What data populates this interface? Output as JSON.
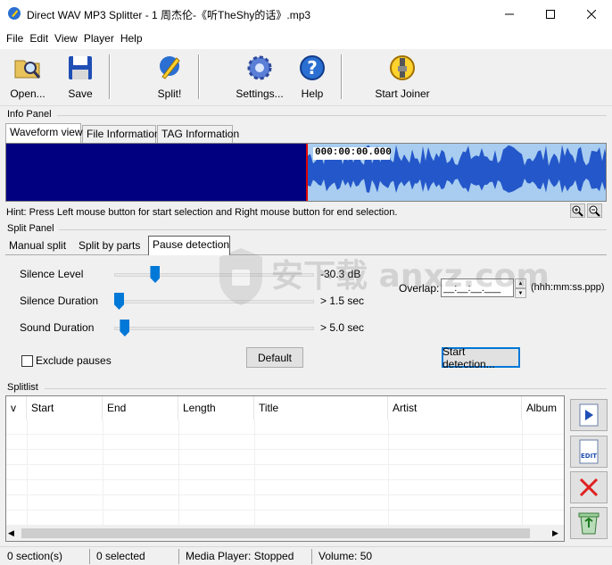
{
  "window": {
    "title": "Direct WAV MP3 Splitter - 1 周杰伦-《听TheShy的话》.mp3"
  },
  "menu": [
    "File",
    "Edit",
    "View",
    "Player",
    "Help"
  ],
  "toolbar": {
    "open": "Open...",
    "save": "Save",
    "split": "Split!",
    "settings": "Settings...",
    "help": "Help",
    "joiner": "Start Joiner"
  },
  "info_panel": {
    "label": "Info Panel",
    "tabs": [
      "Waveform view",
      "File Information",
      "TAG Information"
    ],
    "timecode": "000:00:00.000",
    "hint": "Hint: Press Left mouse button for start selection and Right mouse button for end selection."
  },
  "split_panel": {
    "label": "Split Panel",
    "tabs": [
      "Manual split",
      "Split by parts",
      "Pause detection"
    ],
    "silence_level_label": "Silence Level",
    "silence_level_value": "-30.3 dB",
    "silence_level_fraction": 0.19,
    "silence_duration_label": "Silence Duration",
    "silence_duration_value": "> 1.5 sec",
    "silence_duration_fraction": 0.0,
    "sound_duration_label": "Sound Duration",
    "sound_duration_value": "> 5.0 sec",
    "sound_duration_fraction": 0.03,
    "overlap_label": "Overlap:",
    "overlap_value": "__:__:__.___",
    "overlap_format": "(hhh:mm:ss.ppp)",
    "exclude_pauses": "Exclude pauses",
    "default_btn": "Default",
    "start_detection_btn": "Start detection..."
  },
  "splitlist": {
    "label": "Splitlist",
    "columns": [
      "v",
      "Start",
      "End",
      "Length",
      "Title",
      "Artist",
      "Album"
    ]
  },
  "statusbar": {
    "sections": "0 section(s)",
    "selected": "0 selected",
    "player": "Media Player: Stopped",
    "volume": "Volume: 50"
  },
  "watermark": "安下载 anxz.com",
  "colors": {
    "wave_bg": "#000080",
    "wave_selected_bg": "#a8cdf0",
    "wave_fill": "#2457c9",
    "accent": "#0078d7"
  }
}
